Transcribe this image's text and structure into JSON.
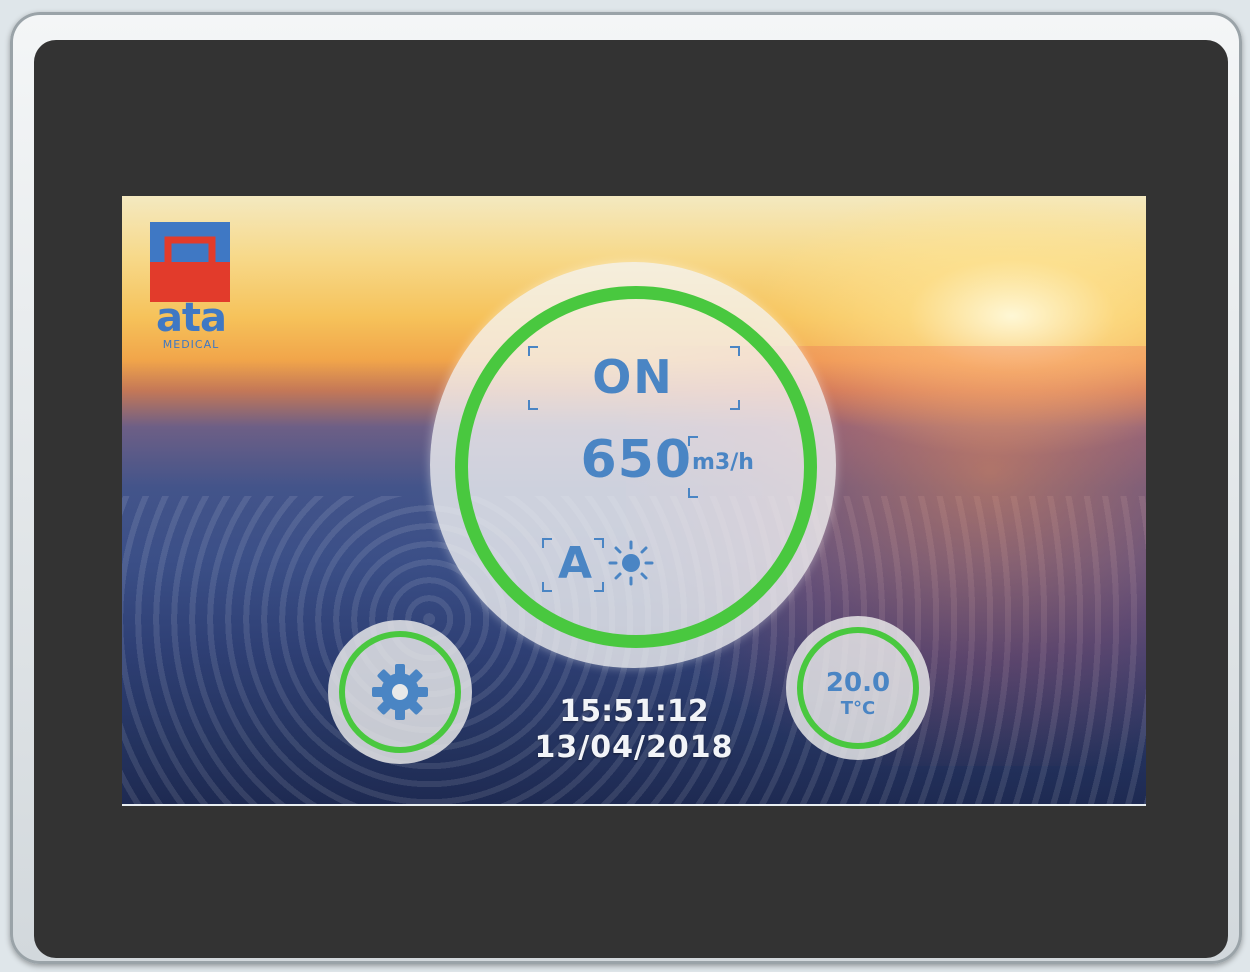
{
  "brand": {
    "logo_word": "ata",
    "logo_sub": "MEDICAL"
  },
  "status": {
    "state": "ON",
    "flow_value": "650",
    "flow_unit": "m3/h",
    "mode_letter": "A",
    "mode_icon": "sun-icon"
  },
  "settings": {
    "icon": "gear-icon"
  },
  "temperature": {
    "value": "20.0",
    "unit": "T°C"
  },
  "clock": {
    "time": "15:51:12",
    "date": "13/04/2018"
  },
  "colors": {
    "ring_green": "#49c83f",
    "text_blue": "#4a85c4",
    "logo_red": "#e23b2b",
    "logo_blue": "#3f78c4"
  }
}
